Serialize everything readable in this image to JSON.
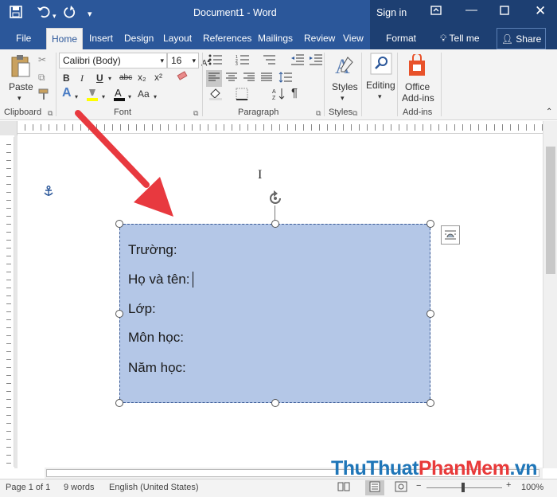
{
  "window": {
    "title": "Document1  -  Word",
    "signin": "Sign in",
    "share": "Share",
    "tell_me": "Tell me"
  },
  "tabs": [
    "File",
    "Home",
    "Insert",
    "Design",
    "Layout",
    "References",
    "Mailings",
    "Review",
    "View"
  ],
  "context_tab": "Format",
  "ribbon": {
    "clipboard": {
      "label": "Clipboard",
      "paste": "Paste"
    },
    "font": {
      "label": "Font",
      "family": "Calibri (Body)",
      "size": "16",
      "bold": "B",
      "italic": "I",
      "underline": "U",
      "strike": "abc",
      "sub": "x₂",
      "sup": "x²",
      "case": "Aa"
    },
    "paragraph": {
      "label": "Paragraph"
    },
    "styles": {
      "label": "Styles",
      "button": "Styles"
    },
    "editing": {
      "button": "Editing"
    },
    "addins": {
      "label": "Add-ins",
      "button_line1": "Office",
      "button_line2": "Add-ins"
    }
  },
  "textbox": {
    "lines": [
      "Trường:",
      "Họ và tên:",
      "Lớp:",
      "Môn học:",
      "Năm học:"
    ],
    "fill": "#b4c7e7"
  },
  "status": {
    "page": "Page 1 of 1",
    "words": "9 words",
    "language": "English (United States)",
    "zoom": "100%"
  },
  "watermark": {
    "part1": "ThuThuat",
    "part2": "PhanMem",
    "part3": ".vn"
  },
  "colors": {
    "brand": "#2b579a",
    "arrow": "#e8393f"
  }
}
